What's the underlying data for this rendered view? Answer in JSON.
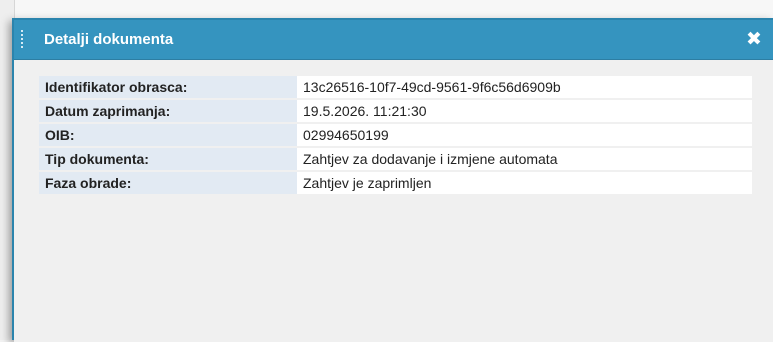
{
  "dialog": {
    "title": "Detalji dokumenta",
    "close_icon": "close-icon",
    "fields": [
      {
        "label": "Identifikator obrasca:",
        "value": "13c26516-10f7-49cd-9561-9f6c56d6909b"
      },
      {
        "label": "Datum zaprimanja:",
        "value": "19.5.2026. 11:21:30"
      },
      {
        "label": "OIB:",
        "value": "02994650199"
      },
      {
        "label": "Tip dokumenta:",
        "value": "Zahtjev za dodavanje i izmjene automata"
      },
      {
        "label": "Faza obrade:",
        "value": "Zahtjev je zaprimljen"
      }
    ]
  },
  "colors": {
    "titlebar": "#3594bf",
    "label_bg": "#e2eaf3",
    "content_bg": "#f0f0f0"
  }
}
